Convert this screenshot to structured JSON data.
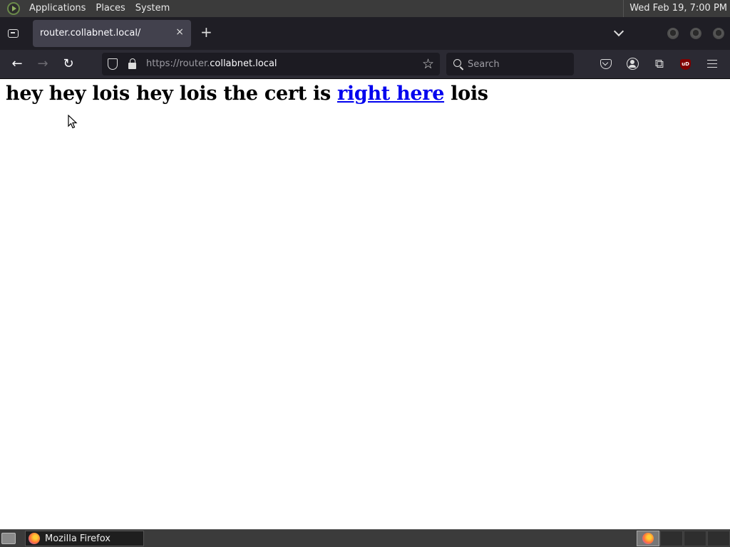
{
  "top_panel": {
    "menus": [
      "Applications",
      "Places",
      "System"
    ],
    "clock": "Wed Feb 19,  7:00 PM"
  },
  "browser": {
    "tab": {
      "title": "router.collabnet.local/",
      "close_glyph": "×"
    },
    "new_tab_glyph": "+",
    "nav": {
      "back_glyph": "←",
      "forward_glyph": "→",
      "reload_glyph": "↻"
    },
    "url": {
      "prefix": "https://router.",
      "host": "collabnet.local"
    },
    "bookmark_glyph": "☆",
    "search": {
      "placeholder": "Search"
    },
    "extensions_glyph": "⧉",
    "ublock_text": "uD"
  },
  "page": {
    "heading_before": "hey hey lois hey lois the cert is ",
    "link_text": "right here",
    "heading_after": " lois"
  },
  "taskbar": {
    "window_label": "Mozilla Firefox"
  },
  "colors": {
    "link": "#0000ee",
    "toolbar_bg": "#2b2a33",
    "tabstrip_bg": "#1f1e25",
    "panel_bg": "#3b3b3b"
  }
}
